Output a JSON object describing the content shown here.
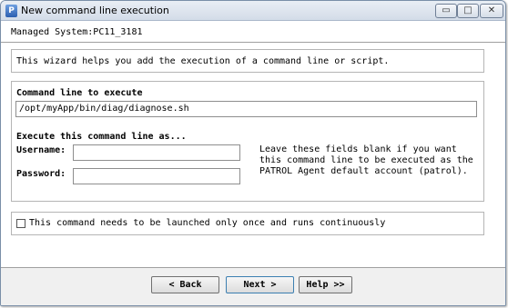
{
  "window": {
    "title": "New command line execution",
    "icon": "patrol-app-icon",
    "controls": {
      "minimize": "▭",
      "maximize": "□",
      "close": "✕"
    }
  },
  "header": {
    "managed_system": "Managed System:PC11_3181"
  },
  "intro": {
    "text": "This wizard helps you add the execution of a command line or script."
  },
  "command": {
    "label": "Command line to execute",
    "value": "/opt/myApp/bin/diag/diagnose.sh"
  },
  "execute_as": {
    "heading": "Execute this command line as...",
    "username_label": "Username:",
    "username_value": "",
    "password_label": "Password:",
    "password_value": "",
    "hint_lines": [
      "Leave these fields blank if you want",
      "this command line to be executed as the",
      "PATROL Agent default account (patrol)."
    ]
  },
  "run_once": {
    "label": "This command needs to be launched only once and runs continuously",
    "checked": false
  },
  "buttons": {
    "back": "< Back",
    "next": "Next >",
    "help": "Help >>"
  }
}
